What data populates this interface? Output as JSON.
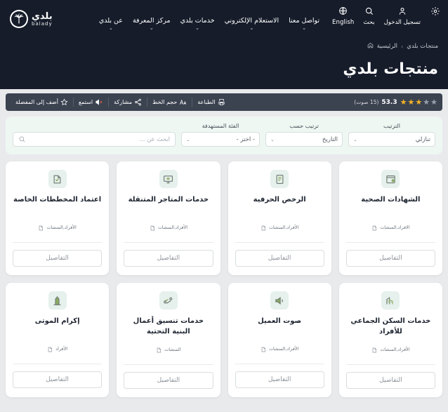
{
  "header": {
    "brand": {
      "ar": "بلدي",
      "en": "balady",
      "icon": "palm-emblem-icon"
    },
    "utilities": [
      {
        "label": "English",
        "icon": "globe-icon"
      },
      {
        "label": "بحث",
        "icon": "search-icon"
      },
      {
        "label": "تسجيل الدخول",
        "icon": "user-icon"
      },
      {
        "label": "",
        "icon": "gear-icon"
      }
    ],
    "nav": [
      {
        "label": "عن بلدي",
        "has_dropdown": true
      },
      {
        "label": "مركز المعرفة",
        "has_dropdown": true
      },
      {
        "label": "خدمات بلدي",
        "has_dropdown": true
      },
      {
        "label": "الاستعلام الإلكتروني",
        "has_dropdown": true
      },
      {
        "label": "تواصل معنا",
        "has_dropdown": true
      }
    ]
  },
  "breadcrumb": {
    "home": "الرئيسية",
    "separator": "›",
    "current": "منتجات بلدي"
  },
  "page_title": "منتجات بلدي",
  "actionbar": {
    "tools": [
      {
        "label": "أضف إلى المفضلة",
        "icon": "star-outline-icon"
      },
      {
        "label": "استمع",
        "icon": "speaker-mute-icon"
      },
      {
        "label": "مشاركة",
        "icon": "share-icon"
      },
      {
        "label": "حجم الخط",
        "icon": "font-size-icon"
      },
      {
        "label": "الطباعة",
        "icon": "print-icon"
      }
    ],
    "rating": {
      "score": "53.3",
      "votes": "(15 صوت)",
      "stars_filled": 3,
      "stars_total": 5,
      "star_on_color": "#f5b324",
      "star_off_color": "#9aa0ab"
    }
  },
  "filters": {
    "sort_order": {
      "label": "الترتيب",
      "value": "تنازلي"
    },
    "sort_by": {
      "label": "ترتيب حسب",
      "value": "التاريخ"
    },
    "category": {
      "label": "الفئة المستهدفة",
      "value": "- اختر -"
    },
    "search": {
      "value": "",
      "placeholder": "ابحث عن ...",
      "icon": "search-icon"
    }
  },
  "cards": [
    {
      "title": "الشهادات الصحية",
      "audience": "الافراد,المنشات",
      "button": "التفاصيل",
      "icon": "health-certificate-icon"
    },
    {
      "title": "الرخص الحرفية",
      "audience": "الأفراد,المنشات",
      "button": "التفاصيل",
      "icon": "craft-license-icon"
    },
    {
      "title": "خدمات المتاجر المتنقلة",
      "audience": "الأفراد,المنشات",
      "button": "التفاصيل",
      "icon": "mobile-store-icon"
    },
    {
      "title": "اعتماد المخططات الخاصة",
      "audience": "الأفراد,المنشات",
      "button": "التفاصيل",
      "icon": "plan-approval-icon"
    },
    {
      "title": "خدمات السكن الجماعي للأفراد",
      "audience": "الأفراد,المنشات",
      "button": "التفاصيل",
      "icon": "group-housing-icon"
    },
    {
      "title": "صوت العميل",
      "audience": "الأفراد,المنشات",
      "button": "التفاصيل",
      "icon": "customer-voice-icon"
    },
    {
      "title": "خدمات تنسيق أعمال البنية التحتية",
      "audience": "المنشات",
      "button": "التفاصيل",
      "icon": "infrastructure-icon"
    },
    {
      "title": "إكرام الموتى",
      "audience": "الأفراد",
      "button": "التفاصيل",
      "icon": "deceased-honor-icon"
    }
  ],
  "colors": {
    "header_bg": "#161c2a",
    "actionbar_bg": "#3b4250",
    "filter_bg": "#eff7f3",
    "page_bg": "#e9eaec",
    "card_bg": "#ffffff",
    "icon_tile_bg": "#e6f0ec",
    "icon_green": "#6e9c5c"
  }
}
